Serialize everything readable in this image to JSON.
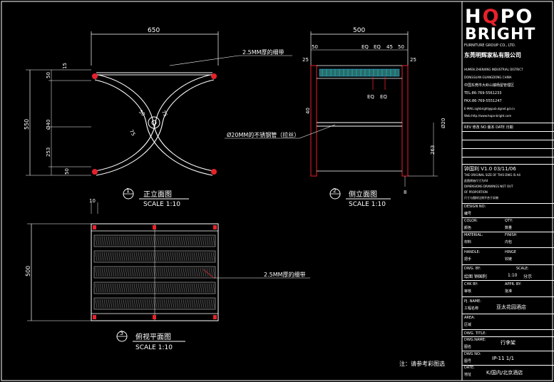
{
  "views": {
    "front": {
      "num": "1",
      "title": "正立面图",
      "scale": "SCALE 1:10"
    },
    "side": {
      "num": "2",
      "title": "侧立面图",
      "scale": "SCALE 1:10"
    },
    "top": {
      "num": "3",
      "title": "俯视平面图",
      "scale": "SCALE 1:10"
    }
  },
  "dims": {
    "front_width": "650",
    "d50a": "50",
    "d15": "15",
    "d550": "550",
    "d40": "Ø40",
    "d253": "253",
    "d50b": "50",
    "r50": "50",
    "r75": "75",
    "r75b": "75",
    "side_width": "500",
    "s50a": "50",
    "s_eq1": "EQ",
    "s_eq2": "EQ",
    "s45": "45",
    "s50b": "50",
    "s25a": "25",
    "s25b": "25",
    "s_eq3": "EQ",
    "s_eq4": "EQ",
    "s_left": "40",
    "s20": "Ø20",
    "s263": "263",
    "s8": "8",
    "top_10": "10",
    "top_500": "500"
  },
  "notes": {
    "belt_front": "2.5MM厚的细带",
    "tube_side": "Ø20MM的不锈钢管（拉丝）",
    "belt_top": "2.5MM厚的细带",
    "bottom_note": "注：请参考彩图选"
  },
  "titleblock": {
    "brand_h": "H",
    "brand_q": "Q",
    "brand_po": "PO",
    "brand_bright": "BRIGHT",
    "furniture": "FURNITURE GROUP CO., LTD.",
    "company_cn": "东莞明辉家私有限公司",
    "addr1": "HUMEN ZHENXING INDUSTRIAL DISTRICT",
    "addr2": "DONGGUAN GUANGDONG CHINA",
    "addr3": "中国东莞市大岭山镇杨屋管理区",
    "tel": "TEL:86-769-5561233",
    "fax": "FAX:86-769-5551247",
    "email": "E-MAIL:sghbright@pub.dgnet.gd.cn",
    "web": "Web:http://www.hopo-bright.com",
    "rev_head": "REV 修改  NO 版本   DATE 日期",
    "version": "钟国利    V1.0   03/11/06",
    "original1": "THE ORIGINAL SIZE OF THIS DWG IS A4",
    "original2": "此图原始尺寸为A4",
    "original3": "DIMENSIONS DRAWINGS NOT OUT",
    "original4": "OF PROPORTION",
    "original5": "尺寸与图样比例不合于实物",
    "design_no": "DESIGN NO:",
    "design_no_cn": "编号",
    "color": "COLOR:",
    "color_cn": "颜色",
    "qty": "QTY:",
    "qty_cn": "数量",
    "material": "MATERIAL:",
    "material_cn": "材料",
    "finish": "FINISH",
    "finish_cn": "内包",
    "handle": "HANDLE:",
    "handle_cn": "把手",
    "hinge": "HINGE",
    "hinge_cn": "铰链",
    "dwg_by": "DWG. BY:",
    "dwg_by_val": "绘图    钟国利",
    "scale": "SCALE:",
    "scale_val": "1:10",
    "scale_cn": "分示",
    "chk_by": "CHK BY:",
    "chk_by_cn": "审核",
    "appr": "APPR. BY:",
    "appr_cn": "批准",
    "pj_name": "PJ. NAME:",
    "pj_name_cn": "工程名称",
    "pj_val": "亚太花园酒店",
    "area": "AREA:",
    "area_cn": "区域",
    "dwg_title": "DWG. TITLE:",
    "dwg_name": "DWG.NAME:",
    "dwg_name_cn": "图名",
    "dwg_name_val": "行李架",
    "dwg_no": "DWG NO:",
    "dwg_no_cn": "图号",
    "dwg_no_val": "IP-11    1/1",
    "date": "DATE:",
    "date_cn": "地址",
    "date_val": "K/国内/北京酒店"
  }
}
